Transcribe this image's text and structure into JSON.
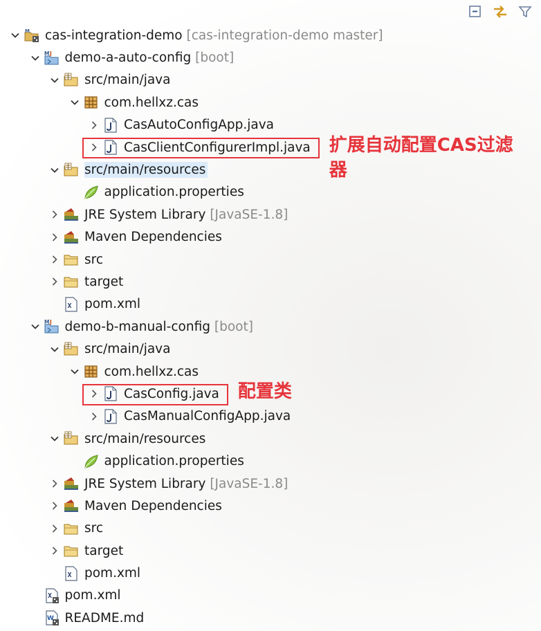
{
  "toolbar": {
    "buttons": [
      "collapse-all-icon",
      "link-with-editor-icon",
      "filter-icon"
    ]
  },
  "tree": [
    {
      "id": "root",
      "depth": 0,
      "chevron": "down",
      "icon": "project",
      "label": "cas-integration-demo",
      "decoration": "[cas-integration-demo master]"
    },
    {
      "id": "a",
      "depth": 1,
      "chevron": "down",
      "icon": "maven-project",
      "label": "demo-a-auto-config",
      "decoration": "[boot]"
    },
    {
      "id": "a-src",
      "depth": 2,
      "chevron": "down",
      "icon": "source-folder",
      "label": "src/main/java",
      "decoration": ""
    },
    {
      "id": "a-pkg",
      "depth": 3,
      "chevron": "down",
      "icon": "package",
      "label": "com.hellxz.cas",
      "decoration": ""
    },
    {
      "id": "a-app",
      "depth": 4,
      "chevron": "right",
      "icon": "java-file",
      "label": "CasAutoConfigApp.java",
      "decoration": ""
    },
    {
      "id": "a-impl",
      "depth": 4,
      "chevron": "right",
      "icon": "java-file",
      "label": "CasClientConfigurerImpl.java",
      "decoration": ""
    },
    {
      "id": "a-res",
      "depth": 2,
      "chevron": "down",
      "icon": "source-folder",
      "label": "src/main/resources",
      "decoration": "",
      "selected": true
    },
    {
      "id": "a-props",
      "depth": 3,
      "chevron": "none",
      "icon": "properties-file",
      "label": "application.properties",
      "decoration": ""
    },
    {
      "id": "a-jre",
      "depth": 2,
      "chevron": "right",
      "icon": "library",
      "label": "JRE System Library",
      "decoration": "[JavaSE-1.8]"
    },
    {
      "id": "a-mvn",
      "depth": 2,
      "chevron": "right",
      "icon": "library",
      "label": "Maven Dependencies",
      "decoration": ""
    },
    {
      "id": "a-srcdir",
      "depth": 2,
      "chevron": "right",
      "icon": "folder",
      "label": "src",
      "decoration": ""
    },
    {
      "id": "a-target",
      "depth": 2,
      "chevron": "right",
      "icon": "folder",
      "label": "target",
      "decoration": ""
    },
    {
      "id": "a-pom",
      "depth": 2,
      "chevron": "none",
      "icon": "xml-file",
      "label": "pom.xml",
      "decoration": ""
    },
    {
      "id": "b",
      "depth": 1,
      "chevron": "down",
      "icon": "maven-project",
      "label": "demo-b-manual-config",
      "decoration": "[boot]"
    },
    {
      "id": "b-src",
      "depth": 2,
      "chevron": "down",
      "icon": "source-folder",
      "label": "src/main/java",
      "decoration": ""
    },
    {
      "id": "b-pkg",
      "depth": 3,
      "chevron": "down",
      "icon": "package",
      "label": "com.hellxz.cas",
      "decoration": ""
    },
    {
      "id": "b-conf",
      "depth": 4,
      "chevron": "right",
      "icon": "java-file",
      "label": "CasConfig.java",
      "decoration": ""
    },
    {
      "id": "b-app",
      "depth": 4,
      "chevron": "right",
      "icon": "java-file",
      "label": "CasManualConfigApp.java",
      "decoration": ""
    },
    {
      "id": "b-res",
      "depth": 2,
      "chevron": "down",
      "icon": "source-folder",
      "label": "src/main/resources",
      "decoration": ""
    },
    {
      "id": "b-props",
      "depth": 3,
      "chevron": "none",
      "icon": "properties-file",
      "label": "application.properties",
      "decoration": ""
    },
    {
      "id": "b-jre",
      "depth": 2,
      "chevron": "right",
      "icon": "library",
      "label": "JRE System Library",
      "decoration": "[JavaSE-1.8]"
    },
    {
      "id": "b-mvn",
      "depth": 2,
      "chevron": "right",
      "icon": "library",
      "label": "Maven Dependencies",
      "decoration": ""
    },
    {
      "id": "b-srcdir",
      "depth": 2,
      "chevron": "right",
      "icon": "folder",
      "label": "src",
      "decoration": ""
    },
    {
      "id": "b-target",
      "depth": 2,
      "chevron": "right",
      "icon": "folder",
      "label": "target",
      "decoration": ""
    },
    {
      "id": "b-pom",
      "depth": 2,
      "chevron": "none",
      "icon": "xml-file",
      "label": "pom.xml",
      "decoration": ""
    },
    {
      "id": "root-pom",
      "depth": 1,
      "chevron": "none",
      "icon": "xml-file-git",
      "label": "pom.xml",
      "decoration": ""
    },
    {
      "id": "root-readme",
      "depth": 1,
      "chevron": "none",
      "icon": "md-file",
      "label": "README.md",
      "decoration": ""
    }
  ],
  "annotations": [
    {
      "target": "a-impl",
      "text": "扩展自动配置CAS过滤器"
    },
    {
      "target": "b-conf",
      "text": "配置类"
    }
  ],
  "colors": {
    "annotation": "#e6343b",
    "selection": "#dcebfa",
    "decoration": "#8a8a8a"
  }
}
